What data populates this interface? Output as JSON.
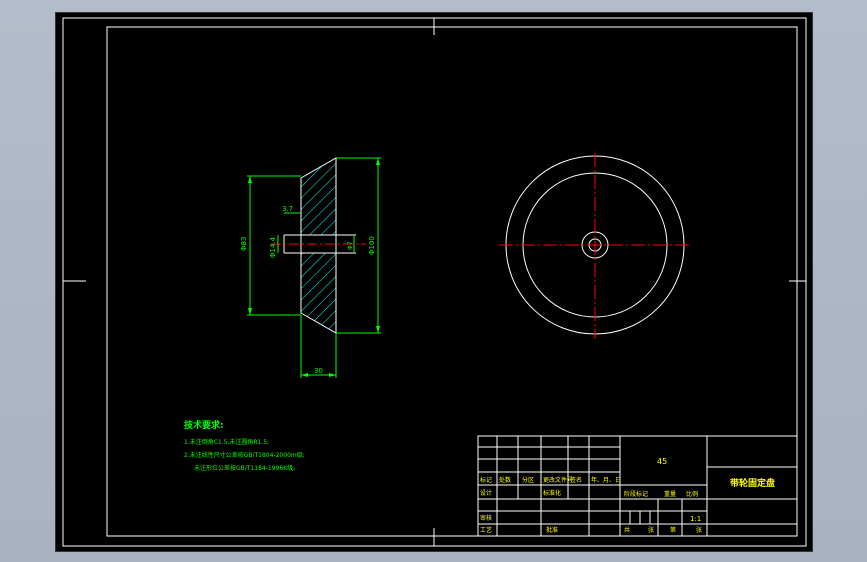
{
  "colors": {
    "background": "#000000",
    "frame": "#ffffff",
    "outline": "#ffffff",
    "dimension": "#00ff00",
    "hatch": "#00ffff",
    "centerline": "#ff0000",
    "title_text": "#ffff00",
    "notes_text": "#00ff00"
  },
  "drawing": {
    "material": "45",
    "part_name": "带轮固定盘",
    "scale": "1:1"
  },
  "dimensions": {
    "total_height": "Φ83",
    "outer_height": "Φ100",
    "width": "30",
    "depth": "3.7",
    "bore": "Φ14.4",
    "small_bore": "Φ7"
  },
  "notes": {
    "title": "技术要求:",
    "line1": "1.未注倒角C1.5,未注圆角R1.5;",
    "line2": "2.未注线性尺寸公差按GB/T1804-2000m级;",
    "line3": "未注形位公差按GB/T1184-1996K级。"
  },
  "title_block": {
    "row_labels": [
      "标记",
      "处数",
      "分区",
      "更改文件号",
      "签名",
      "年、月、日"
    ],
    "designer": "设计",
    "standardization": "标准化",
    "stage_mark": "阶段标记",
    "weight": "重量",
    "ratio": "比例",
    "reviewer": "审核",
    "process": "工艺",
    "approval": "批准",
    "total": "共",
    "sheets": "张",
    "sheet_no": "第",
    "sheet_of": "张"
  }
}
